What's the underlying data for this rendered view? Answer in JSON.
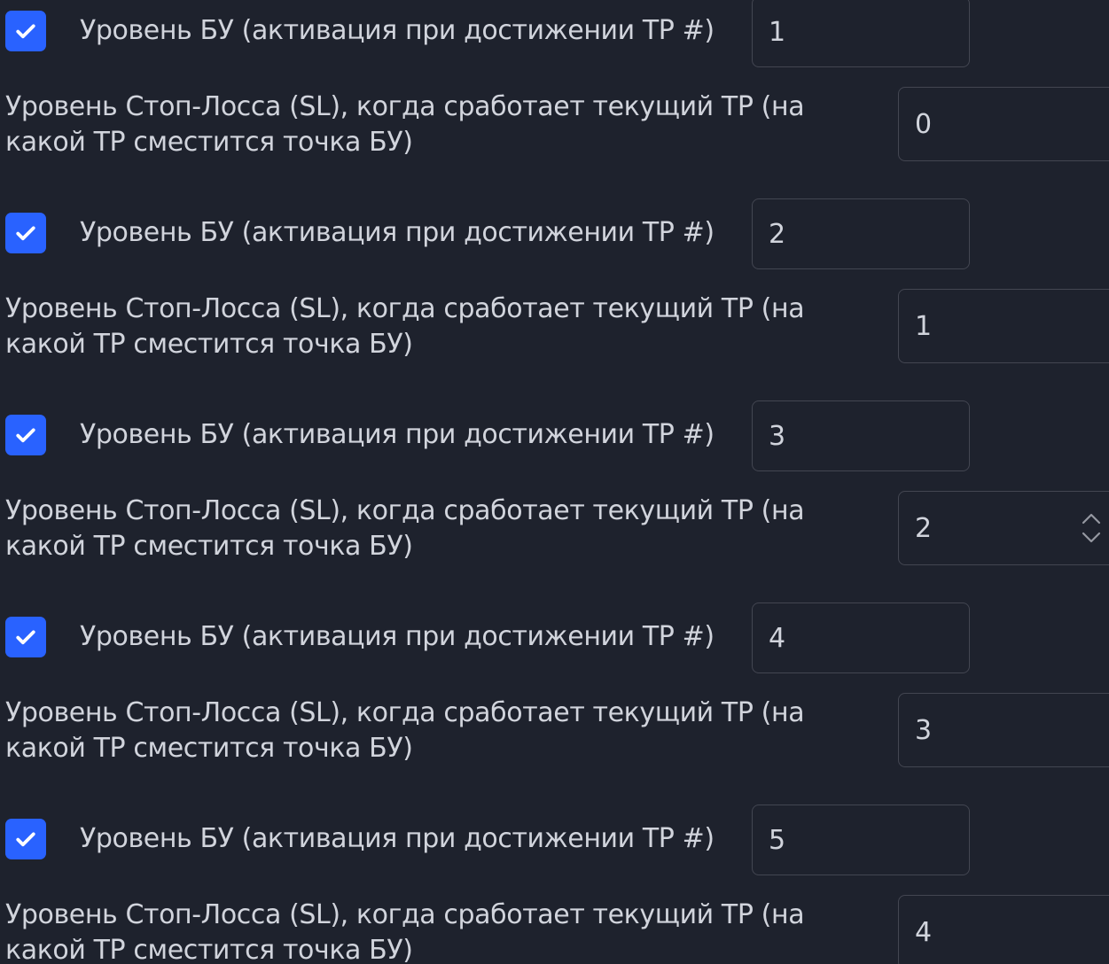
{
  "rows": [
    {
      "be_label": "Уровень БУ (активация при достижении TP #)",
      "be_checked": true,
      "be_value": "1",
      "sl_label": "Уровень Стоп-Лосса (SL), когда сработает текущий TP (на какой TP сместится точка БУ)",
      "sl_value": "0"
    },
    {
      "be_label": "Уровень БУ (активация при достижении TP #)",
      "be_checked": true,
      "be_value": "2",
      "sl_label": "Уровень Стоп-Лосса (SL), когда сработает текущий TP (на какой TP сместится точка БУ)",
      "sl_value": "1"
    },
    {
      "be_label": "Уровень БУ (активация при достижении TP #)",
      "be_checked": true,
      "be_value": "3",
      "sl_label": "Уровень Стоп-Лосса (SL), когда сработает текущий TP (на какой TP сместится точка БУ)",
      "sl_value": "2"
    },
    {
      "be_label": "Уровень БУ (активация при достижении TP #)",
      "be_checked": true,
      "be_value": "4",
      "sl_label": "Уровень Стоп-Лосса (SL), когда сработает текущий TP (на какой TP сместится точка БУ)",
      "sl_value": "3"
    },
    {
      "be_label": "Уровень БУ (активация при достижении TP #)",
      "be_checked": true,
      "be_value": "5",
      "sl_label": "Уровень Стоп-Лосса (SL), когда сработает текущий TP (на какой TP сместится точка БУ)",
      "sl_value": "4"
    }
  ],
  "focused_stepper_row": 2,
  "colors": {
    "background": "#1e222d",
    "checkbox_accent": "#2962ff",
    "text": "#d1d4dc",
    "field_border": "#434651"
  }
}
